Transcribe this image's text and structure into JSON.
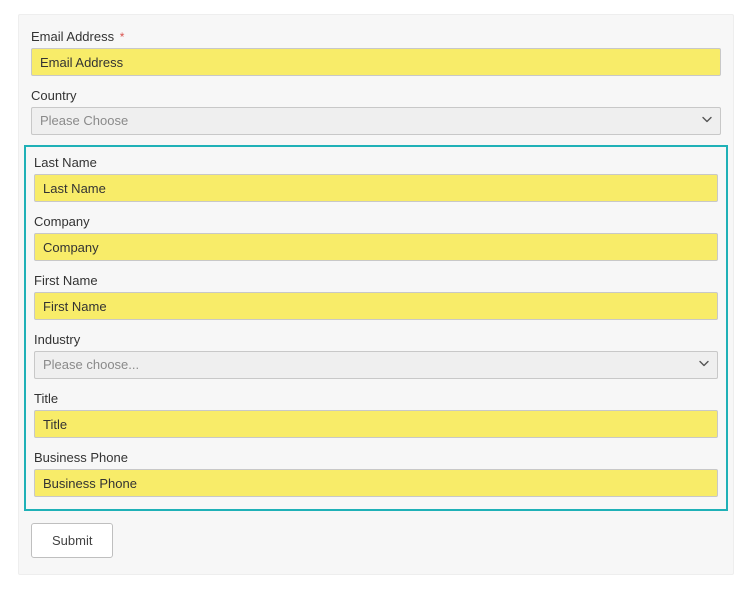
{
  "form": {
    "email": {
      "label": "Email Address",
      "required": true,
      "value": "Email Address"
    },
    "country": {
      "label": "Country",
      "selected": "Please Choose"
    },
    "last_name": {
      "label": "Last Name",
      "value": "Last Name"
    },
    "company": {
      "label": "Company",
      "value": "Company"
    },
    "first_name": {
      "label": "First Name",
      "value": "First Name"
    },
    "industry": {
      "label": "Industry",
      "selected": "Please choose..."
    },
    "title": {
      "label": "Title",
      "value": "Title"
    },
    "business_phone": {
      "label": "Business Phone",
      "value": "Business Phone"
    },
    "submit_label": "Submit",
    "required_marker": "*"
  },
  "colors": {
    "highlight_bg": "#f8ec69",
    "group_border": "#1fb1b7"
  }
}
